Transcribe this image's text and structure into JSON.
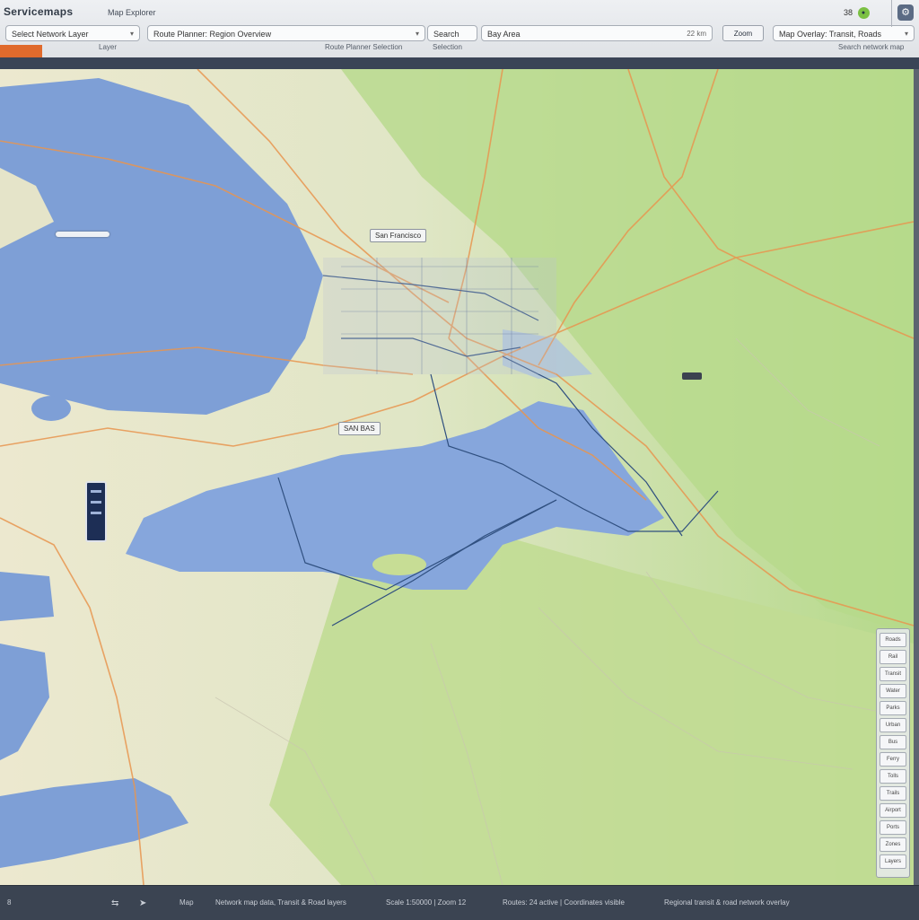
{
  "app": {
    "title": "Servicemaps",
    "subtitle": "Map Explorer",
    "status_count": "38",
    "status_indicator": "●"
  },
  "toolbar": {
    "fields": [
      {
        "value": "Select Network Layer",
        "hint": "Layer"
      },
      {
        "value": "Route Planner: Region Overview",
        "hint": "Route Planner Selection"
      },
      {
        "value": "Search",
        "hint": "Selection"
      },
      {
        "value": "Bay Area",
        "extra": "22 km"
      },
      {
        "value": "Zoom"
      },
      {
        "value": "Map Overlay: Transit, Roads",
        "hint": "Search network map"
      }
    ]
  },
  "map": {
    "labels": {
      "city": "San Francisco",
      "junction": "SAN BAS"
    },
    "legend_items": [
      "Roads",
      "Rail",
      "Transit",
      "Water",
      "Parks",
      "Urban",
      "Bus",
      "Ferry",
      "Tolls",
      "Trails",
      "Airport",
      "Ports",
      "Zones",
      "Layers"
    ]
  },
  "statusbar": {
    "page": "8",
    "items": [
      "Map",
      "Network map data, Transit & Road layers",
      "Scale 1:50000 | Zoom 12",
      "Routes: 24 active | Coordinates visible",
      "Regional transit & road network overlay"
    ]
  },
  "colors": {
    "water": "#7e9fd6",
    "land_green": "#b8d98a",
    "land_light": "#ece8cf",
    "road": "#e8954f",
    "transit": "#2f4f7f",
    "accent": "#e06a2c"
  },
  "icons": [
    "settings-icon",
    "dropdown-arrow-icon",
    "nav-arrow-icon"
  ]
}
